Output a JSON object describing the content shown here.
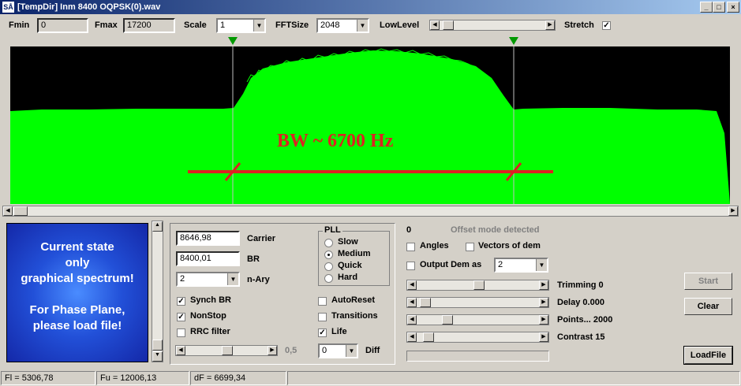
{
  "window": {
    "title": "[TempDir] Inm 8400 OQPSK(0).wav",
    "icon_text": "SÅ",
    "minimize": "_",
    "maximize": "□",
    "close": "×"
  },
  "toolbar": {
    "fmin_label": "Fmin",
    "fmin_value": "0",
    "fmax_label": "Fmax",
    "fmax_value": "17200",
    "scale_label": "Scale",
    "scale_value": "1",
    "fftsize_label": "FFTSize",
    "fftsize_value": "2048",
    "lowlevel_label": "LowLevel",
    "stretch_label": "Stretch",
    "stretch_checked": "✓"
  },
  "spectrum": {
    "annotation": "BW ~ 6700 Hz",
    "colors": {
      "background": "#000000",
      "spectrum": "#00ff00",
      "annotation": "#dd2222"
    }
  },
  "info_panel": {
    "line1": "Current state",
    "line2": "only",
    "line3": "graphical spectrum!",
    "line4": "For Phase Plane,",
    "line5": "please load file!"
  },
  "params": {
    "carrier_value": "8646,98",
    "carrier_label": "Carrier",
    "br_value": "8400,01",
    "br_label": "BR",
    "nary_value": "2",
    "nary_label": "n-Ary",
    "pll_label": "PLL",
    "pll_options": [
      "Slow",
      "Medium",
      "Quick",
      "Hard"
    ],
    "synch_br": "Synch BR",
    "nonstop": "NonStop",
    "rrc_filter": "RRC filter",
    "autoreset": "AutoReset",
    "transitions": "Transitions",
    "life": "Life",
    "slider_value": "0,5",
    "diff_value": "0",
    "diff_label": "Diff",
    "check": "✓"
  },
  "right": {
    "zero": "0",
    "offset_mode": "Offset mode detected",
    "angles": "Angles",
    "vectors": "Vectors of dem",
    "output_dem": "Output Dem as",
    "output_dem_value": "2",
    "trimming": "Trimming 0",
    "delay": "Delay  0.000",
    "points": "Points... 2000",
    "contrast": "Contrast 15",
    "start": "Start",
    "clear": "Clear",
    "loadfile": "LoadFile"
  },
  "statusbar": {
    "fl": "Fl = 5306,78",
    "fu": "Fu = 12006,13",
    "df": "dF = 6699,34"
  }
}
